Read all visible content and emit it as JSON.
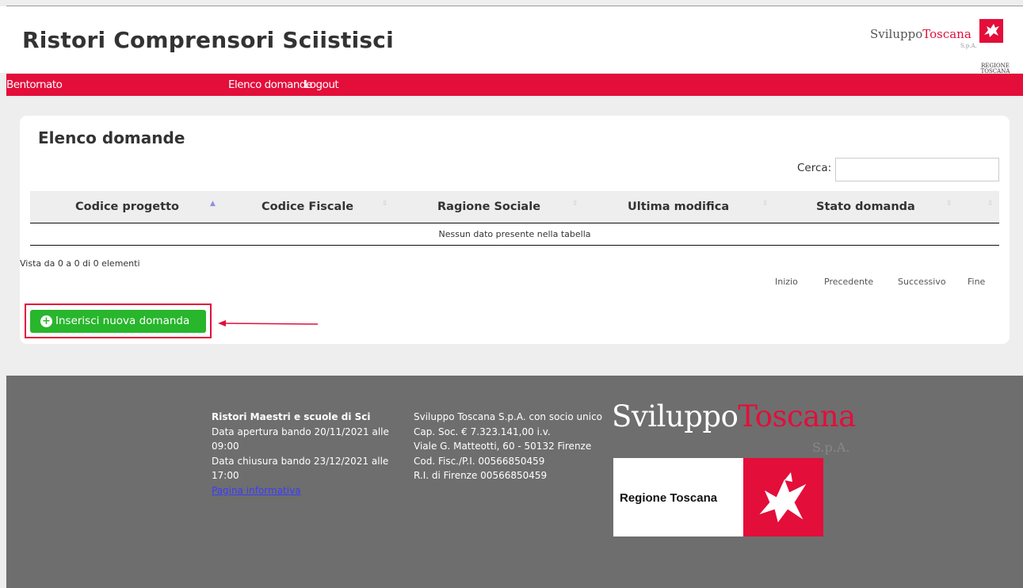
{
  "header": {
    "title": "Ristori Comprensori Sciistisci",
    "brand_small": {
      "part1": "Sviluppo",
      "part2": "Toscana",
      "suffix": "S.p.A."
    },
    "region_label_line1": "REGIONE",
    "region_label_line2": "TOSCANA"
  },
  "nav": {
    "welcome": "Bentornato",
    "list": "Elenco domande",
    "logout": "Logout"
  },
  "main": {
    "title": "Elenco domande",
    "search_label": "Cerca:",
    "search_value": "",
    "columns": [
      "Codice progetto",
      "Codice Fiscale",
      "Ragione Sociale",
      "Ultima modifica",
      "Stato domanda"
    ],
    "empty_text": "Nessun dato presente nella tabella",
    "info_text": "Vista da 0 a 0 di 0 elementi",
    "pager": {
      "first": "Inizio",
      "prev": "Precedente",
      "next": "Successivo",
      "last": "Fine"
    },
    "new_button": "Inserisci nuova domanda"
  },
  "footer": {
    "col1_title": "Ristori Maestri e scuole di Sci",
    "col1_open": "Data apertura bando 20/11/2021 alle 09:00",
    "col1_close": "Data chiusura bando 23/12/2021 alle 17:00",
    "col1_link": "Pagina informativa",
    "col2_line1": "Sviluppo Toscana S.p.A. con socio unico Cap. Soc. € 7.323.141,00 i.v.",
    "col2_line2": "Viale G. Matteotti, 60 - 50132 Firenze",
    "col2_line3": "Cod. Fisc./P.I. 00566850459",
    "col2_line4": "R.I. di Firenze 00566850459",
    "brand_big": {
      "part1": "Sviluppo",
      "part2": "Toscana",
      "suffix": "S.p.A."
    },
    "region_box_label": "Regione Toscana"
  },
  "colors": {
    "accent": "#e30e3a",
    "button_green": "#28b62c",
    "footer_bg": "#6e6e6e"
  }
}
